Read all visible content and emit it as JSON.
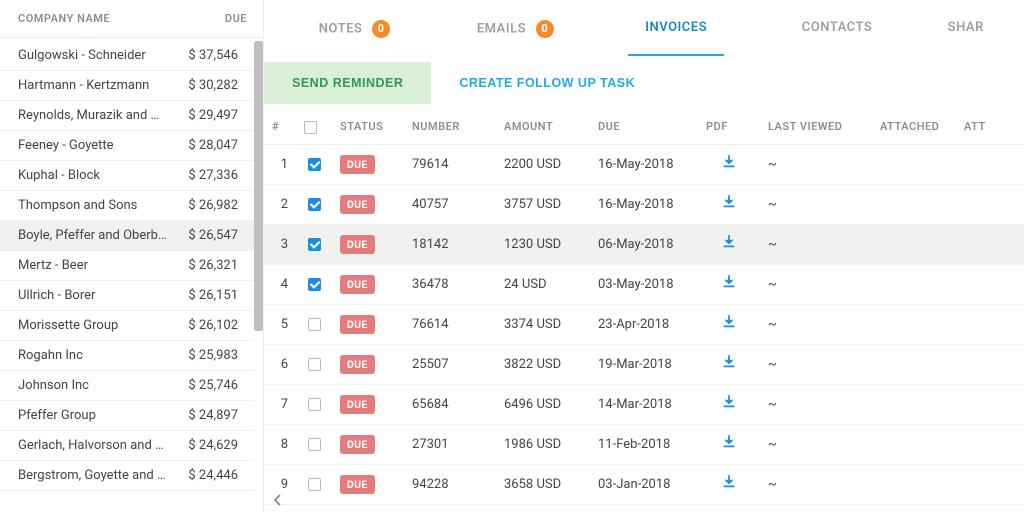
{
  "sidebar": {
    "columns": {
      "company": "COMPANY NAME",
      "due": "DUE"
    },
    "items": [
      {
        "name": "Gulgowski - Schneider",
        "due": "$ 37,546"
      },
      {
        "name": "Hartmann - Kertzmann",
        "due": "$ 30,282"
      },
      {
        "name": "Reynolds, Murazik and Wiza",
        "due": "$ 29,497"
      },
      {
        "name": "Feeney - Goyette",
        "due": "$ 28,047"
      },
      {
        "name": "Kuphal - Block",
        "due": "$ 27,336"
      },
      {
        "name": "Thompson and Sons",
        "due": "$ 26,982"
      },
      {
        "name": "Boyle, Pfeffer and Oberbrunner",
        "due": "$ 26,547"
      },
      {
        "name": "Mertz - Beer",
        "due": "$ 26,321"
      },
      {
        "name": "Ullrich - Borer",
        "due": "$ 26,151"
      },
      {
        "name": "Morissette Group",
        "due": "$ 26,102"
      },
      {
        "name": "Rogahn Inc",
        "due": "$ 25,983"
      },
      {
        "name": "Johnson Inc",
        "due": "$ 25,746"
      },
      {
        "name": "Pfeffer Group",
        "due": "$ 24,897"
      },
      {
        "name": "Gerlach, Halvorson and Kuvalis",
        "due": "$ 24,629"
      },
      {
        "name": "Bergstrom, Goyette and Nikolaus",
        "due": "$ 24,446"
      }
    ],
    "selected_index": 6
  },
  "tabs": {
    "notes": {
      "label": "NOTES",
      "count": "0"
    },
    "emails": {
      "label": "EMAILS",
      "count": "0"
    },
    "invoices": {
      "label": "INVOICES"
    },
    "contacts": {
      "label": "CONTACTS"
    },
    "share": {
      "label": "SHAR"
    }
  },
  "actions": {
    "send_reminder": "SEND REMINDER",
    "create_follow_up": "CREATE FOLLOW UP TASK"
  },
  "invoice_table": {
    "headers": {
      "idx": "#",
      "status": "STATUS",
      "number": "NUMBER",
      "amount": "AMOUNT",
      "due": "DUE",
      "pdf": "PDF",
      "last_viewed": "LAST VIEWED",
      "attached": "ATTACHED",
      "att": "ATT"
    },
    "status_label": "DUE",
    "rows": [
      {
        "idx": "1",
        "checked": true,
        "number": "79614",
        "amount": "2200 USD",
        "due": "16-May-2018",
        "last_viewed": "~"
      },
      {
        "idx": "2",
        "checked": true,
        "number": "40757",
        "amount": "3757 USD",
        "due": "16-May-2018",
        "last_viewed": "~"
      },
      {
        "idx": "3",
        "checked": true,
        "number": "18142",
        "amount": "1230 USD",
        "due": "06-May-2018",
        "last_viewed": "~",
        "highlight": true
      },
      {
        "idx": "4",
        "checked": true,
        "number": "36478",
        "amount": "24 USD",
        "due": "03-May-2018",
        "last_viewed": "~"
      },
      {
        "idx": "5",
        "checked": false,
        "number": "76614",
        "amount": "3374 USD",
        "due": "23-Apr-2018",
        "last_viewed": "~"
      },
      {
        "idx": "6",
        "checked": false,
        "number": "25507",
        "amount": "3822 USD",
        "due": "19-Mar-2018",
        "last_viewed": "~"
      },
      {
        "idx": "7",
        "checked": false,
        "number": "65684",
        "amount": "6496 USD",
        "due": "14-Mar-2018",
        "last_viewed": "~"
      },
      {
        "idx": "8",
        "checked": false,
        "number": "27301",
        "amount": "1986 USD",
        "due": "11-Feb-2018",
        "last_viewed": "~"
      },
      {
        "idx": "9",
        "checked": false,
        "number": "94228",
        "amount": "3658 USD",
        "due": "03-Jan-2018",
        "last_viewed": "~"
      }
    ]
  }
}
